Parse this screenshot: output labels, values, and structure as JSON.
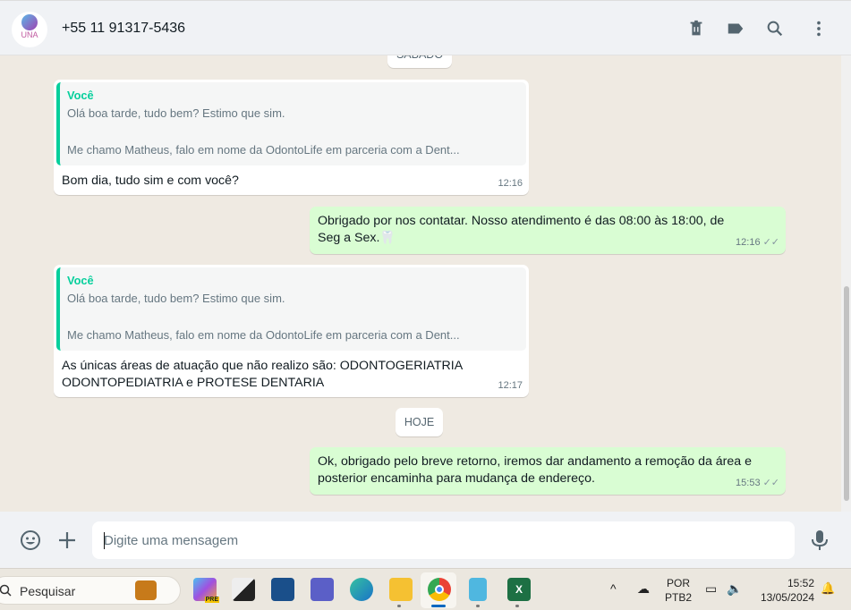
{
  "header": {
    "contact": "+55 11 91317-5436",
    "avatar_text": "UNA",
    "icons": [
      "trash-icon",
      "label-icon",
      "search-icon",
      "menu-icon"
    ]
  },
  "chat": {
    "day_chips": [
      "SÁBADO",
      "HOJE"
    ],
    "messages": [
      {
        "dir": "in",
        "quote_author": "Você",
        "quote_lines": [
          "Olá boa tarde, tudo bem? Estimo que sim.",
          "Me chamo Matheus, falo em nome da OdontoLife em parceria com a Dent..."
        ],
        "text": "Bom dia, tudo sim e com você?",
        "time": "12:16"
      },
      {
        "dir": "out",
        "text": "Obrigado por nos contatar. Nosso atendimento é das 08:00 às 18:00, de Seg a Sex.🦷",
        "time": "12:16",
        "status": "read"
      },
      {
        "dir": "in",
        "quote_author": "Você",
        "quote_lines": [
          "Olá boa tarde, tudo bem? Estimo que sim.",
          "Me chamo Matheus, falo em nome da OdontoLife em parceria com a Dent..."
        ],
        "text": "As únicas áreas de atuação que não realizo são: ODONTOGERIATRIA ODONTOPEDIATRIA e PROTESE DENTARIA",
        "time": "12:17"
      },
      {
        "dir": "out",
        "text": "Ok, obrigado pelo breve retorno, iremos dar andamento a remoção da área e posterior encaminha para mudança de endereço.",
        "time": "15:53",
        "status": "read"
      }
    ]
  },
  "composer": {
    "placeholder": "Digite uma mensagem"
  },
  "taskbar": {
    "search": "Pesquisar",
    "lang1": "POR",
    "lang2": "PTB2",
    "time": "15:52",
    "date": "13/05/2024",
    "copilot_badge": "PRE"
  }
}
